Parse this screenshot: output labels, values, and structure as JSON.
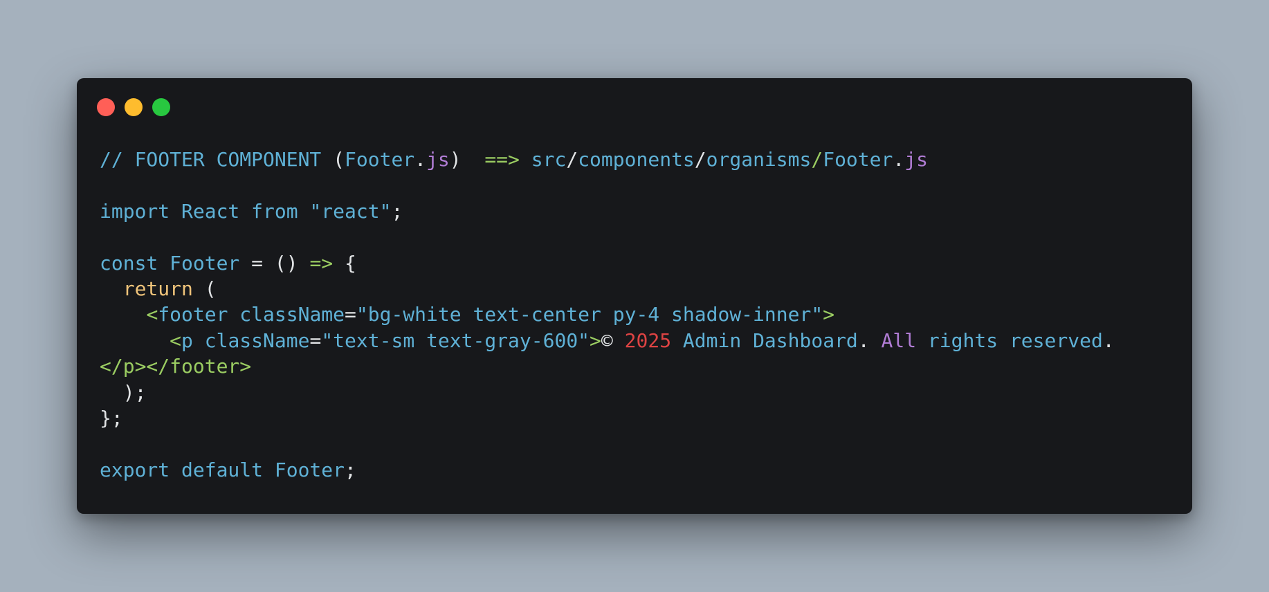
{
  "colors": {
    "background": "#a5b1bd",
    "window": "#17181b",
    "close": "#ff5f57",
    "minimize": "#febc2e",
    "maximize": "#28c840",
    "cyan": "#5fb1d6",
    "purple": "#b07cd4",
    "green": "#9bcd62",
    "yellow": "#efc37a",
    "white": "#e2e4e6",
    "red": "#dd4343"
  },
  "window_controls": [
    {
      "name": "close",
      "icon": "close-dot-icon",
      "color": "#ff5f57"
    },
    {
      "name": "minimize",
      "icon": "minimize-dot-icon",
      "color": "#febc2e"
    },
    {
      "name": "maximize",
      "icon": "maximize-dot-icon",
      "color": "#28c840"
    }
  ],
  "code_lines": [
    [
      {
        "text": "// FOOTER COMPONENT ",
        "class": "t-cyan"
      },
      {
        "text": "(",
        "class": "t-white"
      },
      {
        "text": "Footer",
        "class": "t-cyan"
      },
      {
        "text": ".",
        "class": "t-white"
      },
      {
        "text": "js",
        "class": "t-purple"
      },
      {
        "text": ")  ",
        "class": "t-white"
      },
      {
        "text": "==>",
        "class": "t-green"
      },
      {
        "text": " src",
        "class": "t-cyan"
      },
      {
        "text": "/",
        "class": "t-white"
      },
      {
        "text": "components",
        "class": "t-cyan"
      },
      {
        "text": "/",
        "class": "t-white"
      },
      {
        "text": "organisms",
        "class": "t-cyan"
      },
      {
        "text": "/",
        "class": "t-green"
      },
      {
        "text": "Footer",
        "class": "t-cyan"
      },
      {
        "text": ".",
        "class": "t-white"
      },
      {
        "text": "js",
        "class": "t-purple"
      }
    ],
    [],
    [
      {
        "text": "import React from ",
        "class": "t-cyan"
      },
      {
        "text": "\"react\"",
        "class": "t-cyan"
      },
      {
        "text": ";",
        "class": "t-white"
      }
    ],
    [],
    [
      {
        "text": "const Footer ",
        "class": "t-cyan"
      },
      {
        "text": "= () ",
        "class": "t-white"
      },
      {
        "text": "=>",
        "class": "t-green"
      },
      {
        "text": " {",
        "class": "t-white"
      }
    ],
    [
      {
        "text": "  ",
        "class": "t-white"
      },
      {
        "text": "return",
        "class": "t-yellow"
      },
      {
        "text": " (",
        "class": "t-white"
      }
    ],
    [
      {
        "text": "    ",
        "class": "t-white"
      },
      {
        "text": "<",
        "class": "t-green"
      },
      {
        "text": "footer className",
        "class": "t-cyan"
      },
      {
        "text": "=",
        "class": "t-white"
      },
      {
        "text": "\"bg-white text-center py-4 shadow-inner\"",
        "class": "t-cyan"
      },
      {
        "text": ">",
        "class": "t-green"
      }
    ],
    [
      {
        "text": "      ",
        "class": "t-white"
      },
      {
        "text": "<",
        "class": "t-green"
      },
      {
        "text": "p className",
        "class": "t-cyan"
      },
      {
        "text": "=",
        "class": "t-white"
      },
      {
        "text": "\"text-sm text-gray-600\"",
        "class": "t-cyan"
      },
      {
        "text": ">",
        "class": "t-green"
      },
      {
        "text": "© ",
        "class": "t-white"
      },
      {
        "text": "2025",
        "class": "t-red"
      },
      {
        "text": " Admin Dashboard",
        "class": "t-cyan"
      },
      {
        "text": ". ",
        "class": "t-white"
      },
      {
        "text": "All",
        "class": "t-purple"
      },
      {
        "text": " rights reserved",
        "class": "t-cyan"
      },
      {
        "text": ".",
        "class": "t-white"
      }
    ],
    [
      {
        "text": "</p></footer>",
        "class": "t-green"
      }
    ],
    [
      {
        "text": "  );",
        "class": "t-white"
      }
    ],
    [
      {
        "text": "};",
        "class": "t-white"
      }
    ],
    [],
    [
      {
        "text": "export default Footer",
        "class": "t-cyan"
      },
      {
        "text": ";",
        "class": "t-white"
      }
    ]
  ]
}
